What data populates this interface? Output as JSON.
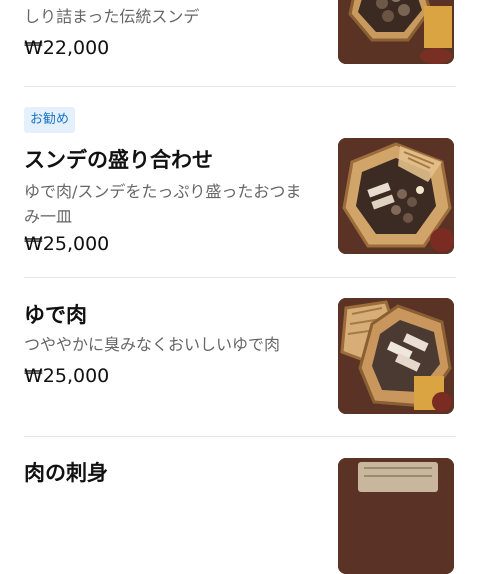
{
  "items": [
    {
      "title": "",
      "description_lines": [
        "しり詰まった伝統スンデ"
      ],
      "price": "₩22,000",
      "image": "sundae-platter-photo"
    },
    {
      "badge": "お勧め",
      "title": "スンデの盛り合わせ",
      "description_lines": [
        "ゆで肉/スンデをたっぷり盛ったおつま",
        "み一皿"
      ],
      "price": "₩25,000",
      "image": "sundae-assorted-platter-photo"
    },
    {
      "title": "ゆで肉",
      "description_lines": [
        "つややかに臭みなくおいしいゆで肉"
      ],
      "price": "₩25,000",
      "image": "boiled-pork-platter-photo"
    },
    {
      "title": "肉の刺身",
      "description_lines": [],
      "price": "",
      "image": "raw-meat-platter-photo"
    }
  ]
}
